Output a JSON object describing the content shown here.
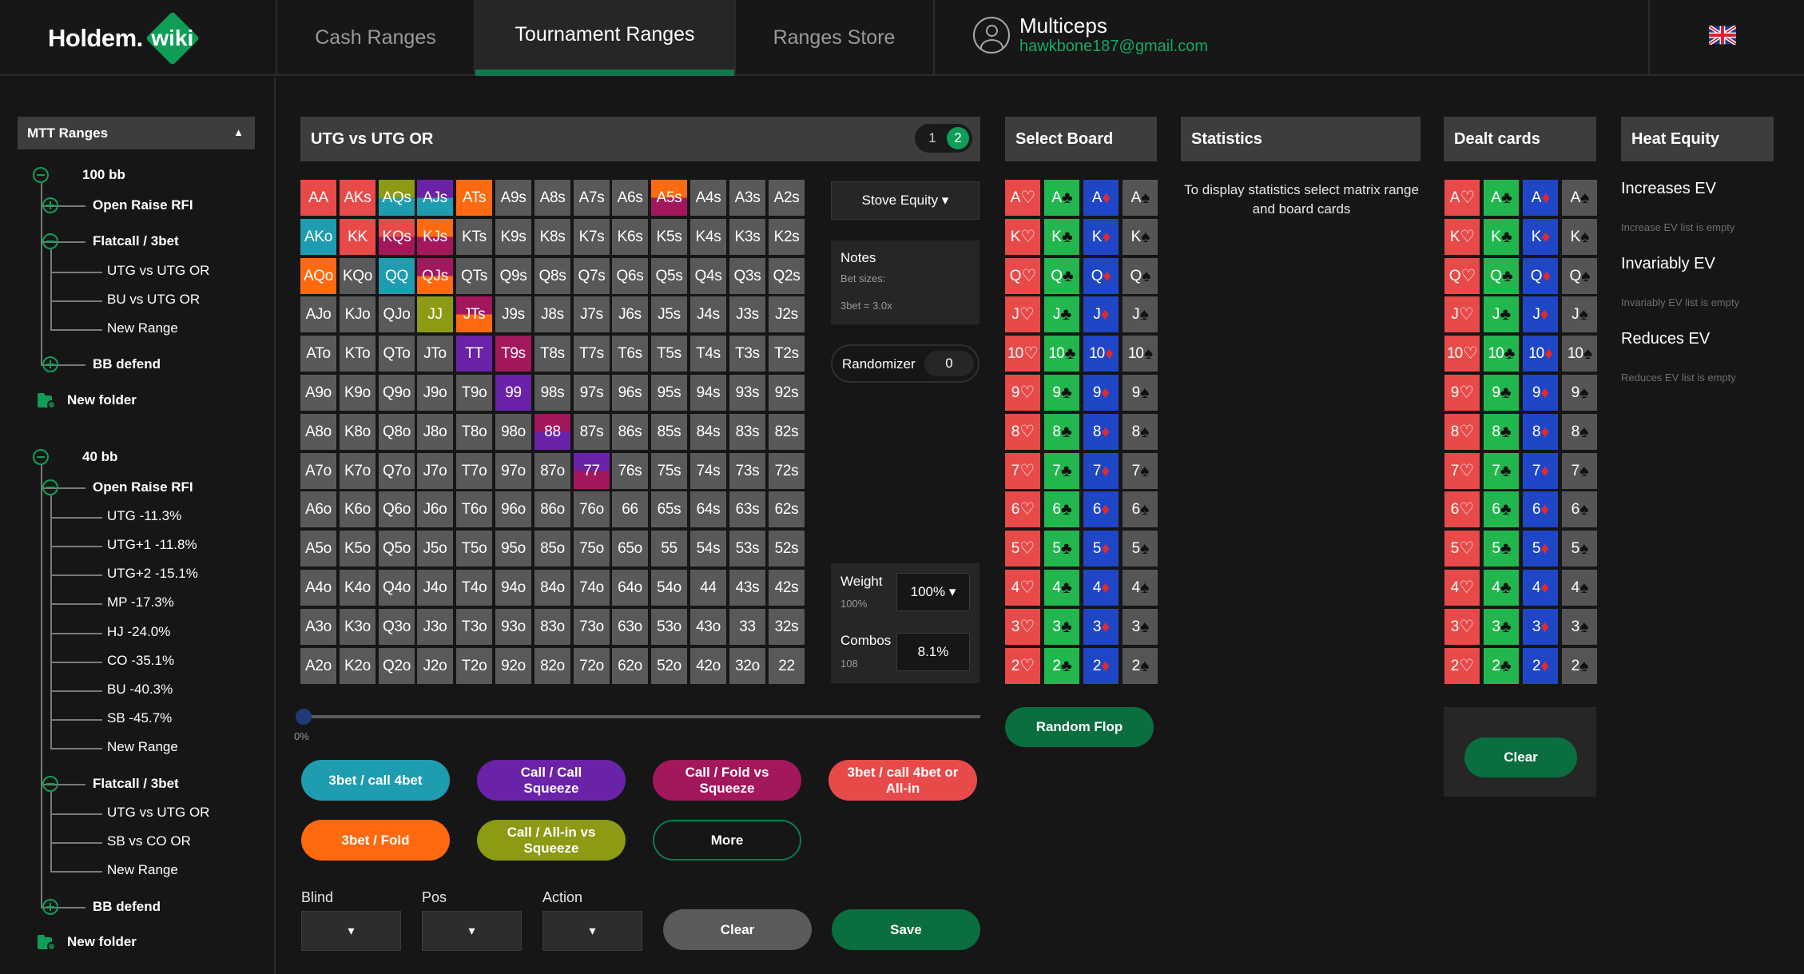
{
  "nav": {
    "logo_word": "Holdem.",
    "logo_badge": "wiki",
    "tabs": [
      "Cash Ranges",
      "Tournament Ranges",
      "Ranges Store"
    ],
    "active_tab": "Tournament Ranges",
    "user_name": "Multiceps",
    "user_email": "hawkbone187@gmail.com",
    "language_flag": "uk-flag-icon"
  },
  "sidebar": {
    "header": "MTT Ranges",
    "header_caret": "▲",
    "groups": [
      {
        "label": "100 bb",
        "children": [
          {
            "label": "Open Raise RFI"
          },
          {
            "label": "Flatcall / 3bet",
            "items": [
              "UTG vs UTG OR",
              "BU vs UTG OR",
              "New Range"
            ]
          },
          {
            "label": "BB defend"
          }
        ],
        "new_folder": "New folder"
      },
      {
        "label": "40 bb",
        "children": [
          {
            "label": "Open Raise RFI",
            "items": [
              "UTG -11.3%",
              "UTG+1 -11.8%",
              "UTG+2 -15.1%",
              "MP -17.3%",
              "HJ -24.0%",
              "CO -35.1%",
              "BU -40.3%",
              "SB -45.7%",
              "New Range"
            ]
          },
          {
            "label": "Flatcall / 3bet",
            "items": [
              "UTG vs UTG OR",
              "SB vs CO OR",
              "New Range"
            ]
          },
          {
            "label": "BB defend"
          }
        ],
        "new_folder": "New folder"
      }
    ]
  },
  "range": {
    "title": "UTG vs UTG OR",
    "pages": [
      "1",
      "2"
    ],
    "active_page": "2",
    "colors": {
      "default": "#595959",
      "red": "#e84a4a",
      "teal": "#1e9cb0",
      "orange": "#ff6a10",
      "purple": "#6a23a8",
      "magenta": "#a3175d",
      "olive": "#8c9a14"
    },
    "cells": [
      [
        "AA",
        "AKs",
        "AQs",
        "AJs",
        "ATs",
        "A9s",
        "A8s",
        "A7s",
        "A6s",
        "A5s",
        "A4s",
        "A3s",
        "A2s"
      ],
      [
        "AKo",
        "KK",
        "KQs",
        "KJs",
        "KTs",
        "K9s",
        "K8s",
        "K7s",
        "K6s",
        "K5s",
        "K4s",
        "K3s",
        "K2s"
      ],
      [
        "AQo",
        "KQo",
        "QQ",
        "QJs",
        "QTs",
        "Q9s",
        "Q8s",
        "Q7s",
        "Q6s",
        "Q5s",
        "Q4s",
        "Q3s",
        "Q2s"
      ],
      [
        "AJo",
        "KJo",
        "QJo",
        "JJ",
        "JTs",
        "J9s",
        "J8s",
        "J7s",
        "J6s",
        "J5s",
        "J4s",
        "J3s",
        "J2s"
      ],
      [
        "ATo",
        "KTo",
        "QTo",
        "JTo",
        "TT",
        "T9s",
        "T8s",
        "T7s",
        "T6s",
        "T5s",
        "T4s",
        "T3s",
        "T2s"
      ],
      [
        "A9o",
        "K9o",
        "Q9o",
        "J9o",
        "T9o",
        "99",
        "98s",
        "97s",
        "96s",
        "95s",
        "94s",
        "93s",
        "92s"
      ],
      [
        "A8o",
        "K8o",
        "Q8o",
        "J8o",
        "T8o",
        "98o",
        "88",
        "87s",
        "86s",
        "85s",
        "84s",
        "83s",
        "82s"
      ],
      [
        "A7o",
        "K7o",
        "Q7o",
        "J7o",
        "T7o",
        "97o",
        "87o",
        "77",
        "76s",
        "75s",
        "74s",
        "73s",
        "72s"
      ],
      [
        "A6o",
        "K6o",
        "Q6o",
        "J6o",
        "T6o",
        "96o",
        "86o",
        "76o",
        "66",
        "65s",
        "64s",
        "63s",
        "62s"
      ],
      [
        "A5o",
        "K5o",
        "Q5o",
        "J5o",
        "T5o",
        "95o",
        "85o",
        "75o",
        "65o",
        "55",
        "54s",
        "53s",
        "52s"
      ],
      [
        "A4o",
        "K4o",
        "Q4o",
        "J4o",
        "T4o",
        "94o",
        "84o",
        "74o",
        "64o",
        "54o",
        "44",
        "43s",
        "42s"
      ],
      [
        "A3o",
        "K3o",
        "Q3o",
        "J3o",
        "T3o",
        "93o",
        "83o",
        "73o",
        "63o",
        "53o",
        "43o",
        "33",
        "32s"
      ],
      [
        "A2o",
        "K2o",
        "Q2o",
        "J2o",
        "T2o",
        "92o",
        "82o",
        "72o",
        "62o",
        "52o",
        "42o",
        "32o",
        "22"
      ]
    ],
    "cell_colors": {
      "AA": [
        "red"
      ],
      "AKs": [
        "red"
      ],
      "AQs": [
        "olive",
        "teal"
      ],
      "AJs": [
        "purple",
        "teal"
      ],
      "ATs": [
        "orange"
      ],
      "A5s": [
        "orange",
        "magenta"
      ],
      "AKo": [
        "teal"
      ],
      "KK": [
        "red"
      ],
      "KQs": [
        "red",
        "magenta"
      ],
      "KJs": [
        "orange",
        "magenta"
      ],
      "AQo": [
        "orange"
      ],
      "QQ": [
        "teal"
      ],
      "QJs": [
        "magenta",
        "orange"
      ],
      "JJ": [
        "olive"
      ],
      "JTs": [
        "magenta",
        "orange"
      ],
      "TT": [
        "purple"
      ],
      "T9s": [
        "magenta"
      ],
      "99": [
        "purple"
      ],
      "88": [
        "magenta",
        "purple"
      ],
      "77": [
        "purple",
        "magenta"
      ]
    },
    "stove_equity": "Stove Equity ▾",
    "notes_title": "Notes",
    "notes_line1": "Bet sizes:",
    "notes_line2": "3bet = 3.0x",
    "randomizer_label": "Randomizer",
    "randomizer_value": "0",
    "weight_label": "Weight",
    "weight_sub": "100%",
    "weight_select": "100% ▾",
    "combos_label": "Combos",
    "combos_sub": "108",
    "combos_value": "8.1%",
    "slider_value_label": "0%",
    "slider_value": 0,
    "actions": [
      {
        "label": "3bet / call 4bet",
        "color": "#1e9cb0"
      },
      {
        "label": "Call / Call Squeeze",
        "color": "#6a23a8"
      },
      {
        "label": "Call / Fold vs Squeeze",
        "color": "#a3175d"
      },
      {
        "label": "3bet / call 4bet or All-in",
        "color": "#e84a4a"
      },
      {
        "label": "3bet / Fold",
        "color": "#ff6a10"
      },
      {
        "label": "Call / All-in vs Squeeze",
        "color": "#8c9a14"
      },
      {
        "label": "More",
        "color": "#161616"
      }
    ],
    "filters": {
      "blind_label": "Blind",
      "pos_label": "Pos",
      "action_label": "Action",
      "select_glyph": "▾"
    },
    "clear_label": "Clear",
    "save_label": "Save"
  },
  "board": {
    "title": "Select Board",
    "ranks": [
      "A",
      "K",
      "Q",
      "J",
      "10",
      "9",
      "8",
      "7",
      "6",
      "5",
      "4",
      "3",
      "2"
    ],
    "suits": [
      "♡",
      "♣",
      "♦",
      "♠"
    ],
    "random_flop": "Random Flop"
  },
  "statistics": {
    "title": "Statistics",
    "message": "To display statistics select matrix range and board cards"
  },
  "dealt": {
    "title": "Dealt cards",
    "clear_label": "Clear"
  },
  "heat_equity": {
    "title": "Heat Equity",
    "increases": "Increases EV",
    "increases_empty": "Increase EV list is empty",
    "invariably": "Invariably EV",
    "invariably_empty": "Invariably EV list is empty",
    "reduces": "Reduces EV",
    "reduces_empty": "Reduces EV list is empty"
  }
}
